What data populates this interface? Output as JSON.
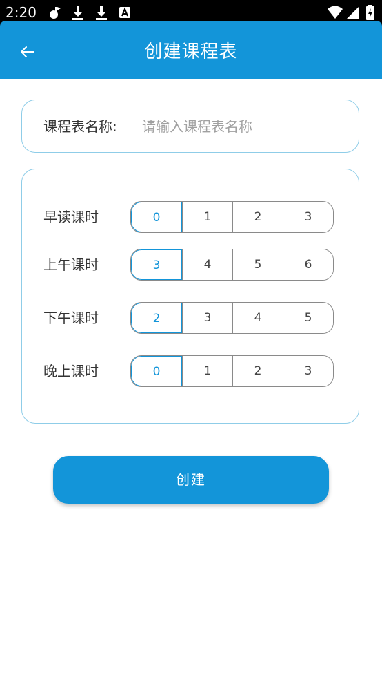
{
  "status_bar": {
    "time": "2:20",
    "icons_left": [
      "notification-icon",
      "download-icon",
      "download-icon",
      "app-icon"
    ],
    "icons_right": [
      "wifi-icon",
      "signal-icon",
      "battery-charging-icon"
    ]
  },
  "app_bar": {
    "title": "创建课程表",
    "back_icon": "arrow-left-icon",
    "color": "#1395d9"
  },
  "name_field": {
    "label": "课程表名称:",
    "placeholder": "请输入课程表名称",
    "value": ""
  },
  "periods": [
    {
      "label": "早读课时",
      "options": [
        "0",
        "1",
        "2",
        "3"
      ],
      "selected": "0"
    },
    {
      "label": "上午课时",
      "options": [
        "3",
        "4",
        "5",
        "6"
      ],
      "selected": "3"
    },
    {
      "label": "下午课时",
      "options": [
        "2",
        "3",
        "4",
        "5"
      ],
      "selected": "2"
    },
    {
      "label": "晚上课时",
      "options": [
        "0",
        "1",
        "2",
        "3"
      ],
      "selected": "0"
    }
  ],
  "create_button": {
    "label": "创建"
  },
  "colors": {
    "accent": "#1395d9",
    "card_border": "#8fcde8",
    "segment_border": "#8a8a8a"
  }
}
